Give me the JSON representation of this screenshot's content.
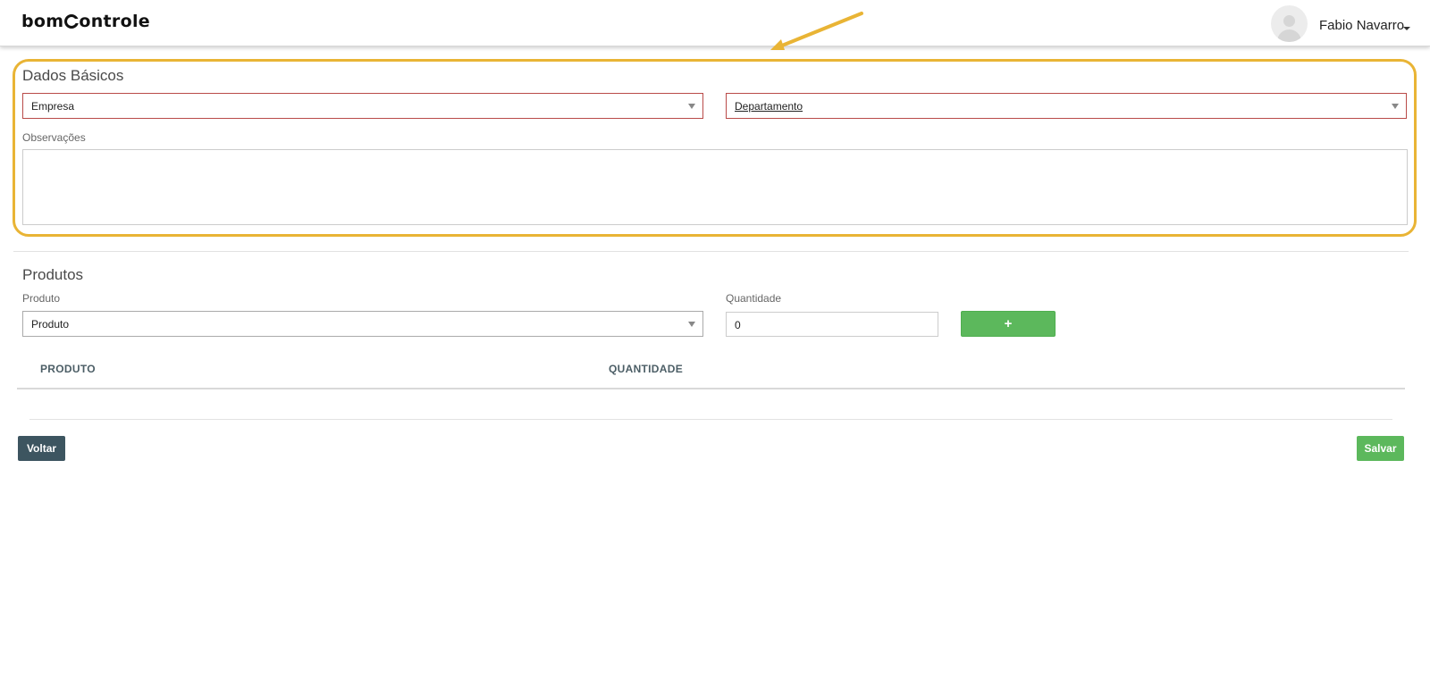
{
  "header": {
    "logo_text_left": "bom",
    "logo_text_right": "ontrole",
    "user_name": "Fabio Navarro"
  },
  "dados_basicos": {
    "title": "Dados Básicos",
    "empresa_select": "Empresa",
    "departamento_select": "Departamento",
    "observacoes_label": "Observações",
    "observacoes_value": ""
  },
  "produtos": {
    "title": "Produtos",
    "produto_label": "Produto",
    "produto_select": "Produto",
    "quantidade_label": "Quantidade",
    "quantidade_value": "0",
    "add_button": "+",
    "table_headers": [
      "PRODUTO",
      "QUANTIDADE"
    ]
  },
  "footer": {
    "back_button": "Voltar",
    "save_button": "Salvar"
  },
  "colors": {
    "highlight": "#e9b435",
    "success": "#5cb85c",
    "dark_button": "#3d5560",
    "error_border": "#b94a48"
  },
  "icons": {
    "user_menu_caret": "caret-down-icon",
    "select_arrow": "triangle-down-icon",
    "annotation": "arrow-annotation-icon"
  }
}
